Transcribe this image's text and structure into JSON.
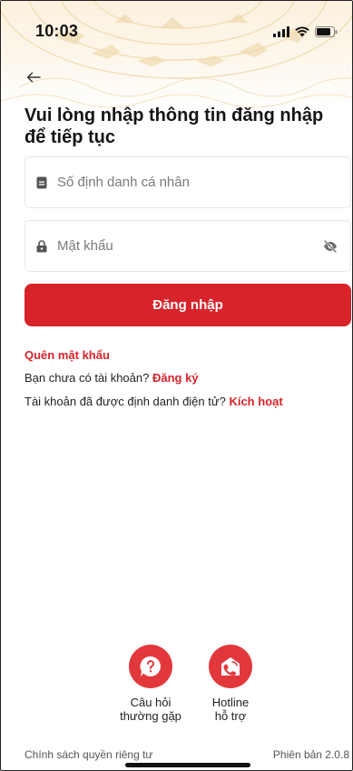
{
  "status": {
    "time": "10:03"
  },
  "title": "Vui lòng nhập thông tin đăng nhập để tiếp tục",
  "form": {
    "id_placeholder": "Số định danh cá nhân",
    "password_placeholder": "Mật khẩu",
    "login_label": "Đăng nhập"
  },
  "links": {
    "forgot_password": "Quên mật khẩu",
    "no_account_text": "Bạn chưa có tài khoản?",
    "register": "Đăng ký",
    "identified_text": "Tài khoản đã được định danh điện tử?",
    "activate": "Kích hoạt"
  },
  "help": {
    "faq_line1": "Câu hỏi",
    "faq_line2": "thường gặp",
    "hotline_line1": "Hotline",
    "hotline_line2": "hỗ trợ"
  },
  "footer": {
    "privacy": "Chính sách quyền riêng tư",
    "version": "Phiên bản 2.0.8"
  },
  "colors": {
    "accent": "#d8232a",
    "help_icon_bg": "#e2383c",
    "header_tint": "#fbf1de"
  },
  "icons": [
    "back-arrow-icon",
    "id-card-icon",
    "lock-icon",
    "eye-slash-icon",
    "question-bubble-icon",
    "hotline-icon",
    "signal-icon",
    "wifi-icon",
    "battery-icon"
  ]
}
